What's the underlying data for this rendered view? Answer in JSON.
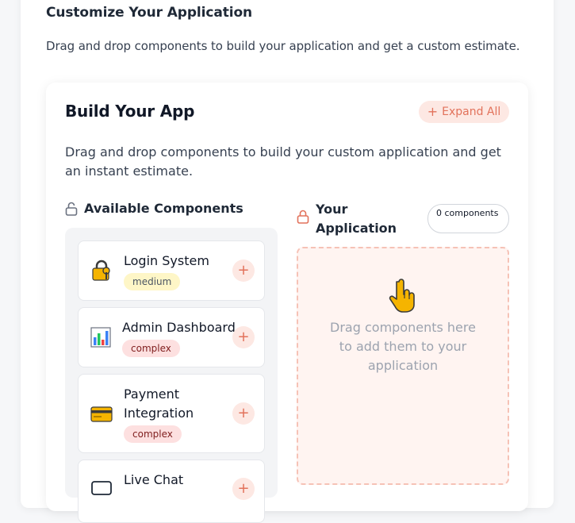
{
  "page": {
    "title": "Customize Your Application",
    "description": "Drag and drop components to build your application and get a custom estimate."
  },
  "builder": {
    "title": "Build Your App",
    "expand_label": "Expand All",
    "description": "Drag and drop components to build your custom application and get an instant estimate."
  },
  "available": {
    "heading": "Available Components",
    "components": [
      {
        "name": "Login System",
        "complexity": "medium",
        "icon": "lock-key-icon"
      },
      {
        "name": "Admin Dashboard",
        "complexity": "complex",
        "icon": "bar-chart-icon"
      },
      {
        "name": "Payment Integration",
        "complexity": "complex",
        "icon": "credit-card-icon"
      },
      {
        "name": "Live Chat",
        "complexity": "",
        "icon": "chat-icon"
      }
    ]
  },
  "selection": {
    "heading": "Your Application",
    "count_label": "0 components",
    "drop_hint": "Drag components here to add them to your application"
  },
  "colors": {
    "accent": "#e2725b",
    "accent_bg": "#fde8e3",
    "medium_badge": "#fef6c7",
    "complex_badge": "#fde0e0"
  }
}
